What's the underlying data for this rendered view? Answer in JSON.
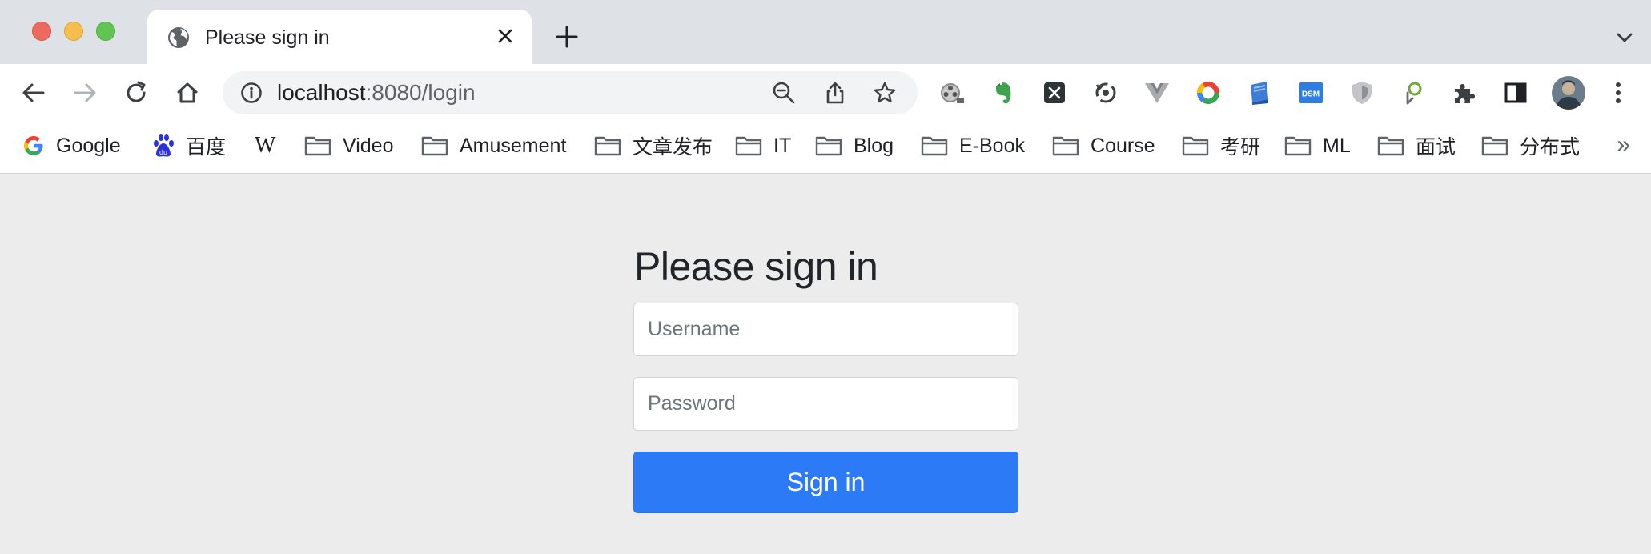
{
  "tab": {
    "title": "Please sign in"
  },
  "url": {
    "host": "localhost",
    "rest": ":8080/login"
  },
  "bookmarks": [
    {
      "label": "Google",
      "icon": "google-icon"
    },
    {
      "label": "百度",
      "icon": "baidu-icon"
    },
    {
      "label": "",
      "icon": "wikipedia-icon"
    },
    {
      "label": "Video",
      "icon": "folder-icon"
    },
    {
      "label": "Amusement",
      "icon": "folder-icon"
    },
    {
      "label": "文章发布",
      "icon": "folder-icon"
    },
    {
      "label": "IT",
      "icon": "folder-icon"
    },
    {
      "label": "Blog",
      "icon": "folder-icon"
    },
    {
      "label": "E-Book",
      "icon": "folder-icon"
    },
    {
      "label": "Course",
      "icon": "folder-icon"
    },
    {
      "label": "考研",
      "icon": "folder-icon"
    },
    {
      "label": "ML",
      "icon": "folder-icon"
    },
    {
      "label": "面试",
      "icon": "folder-icon"
    },
    {
      "label": "分布式",
      "icon": "folder-icon"
    }
  ],
  "bookmarks_overflow": "»",
  "extensions": [
    "film-reel-icon",
    "evernote-icon",
    "x-extension-icon",
    "sync-icon",
    "vue-devtools-icon",
    "chrome-color-icon",
    "book-icon",
    "dsm-icon",
    "shield-extension-icon",
    "leaf-extension-icon",
    "puzzle-icon",
    "sidebar-icon"
  ],
  "wiki_glyph": "W",
  "dsm_label": "DSM",
  "form": {
    "heading": "Please sign in",
    "username_placeholder": "Username",
    "password_placeholder": "Password",
    "submit_label": "Sign in"
  },
  "colors": {
    "primary": "#2c7af6",
    "page_bg": "#ececec",
    "tab_strip": "#dee1e6"
  }
}
